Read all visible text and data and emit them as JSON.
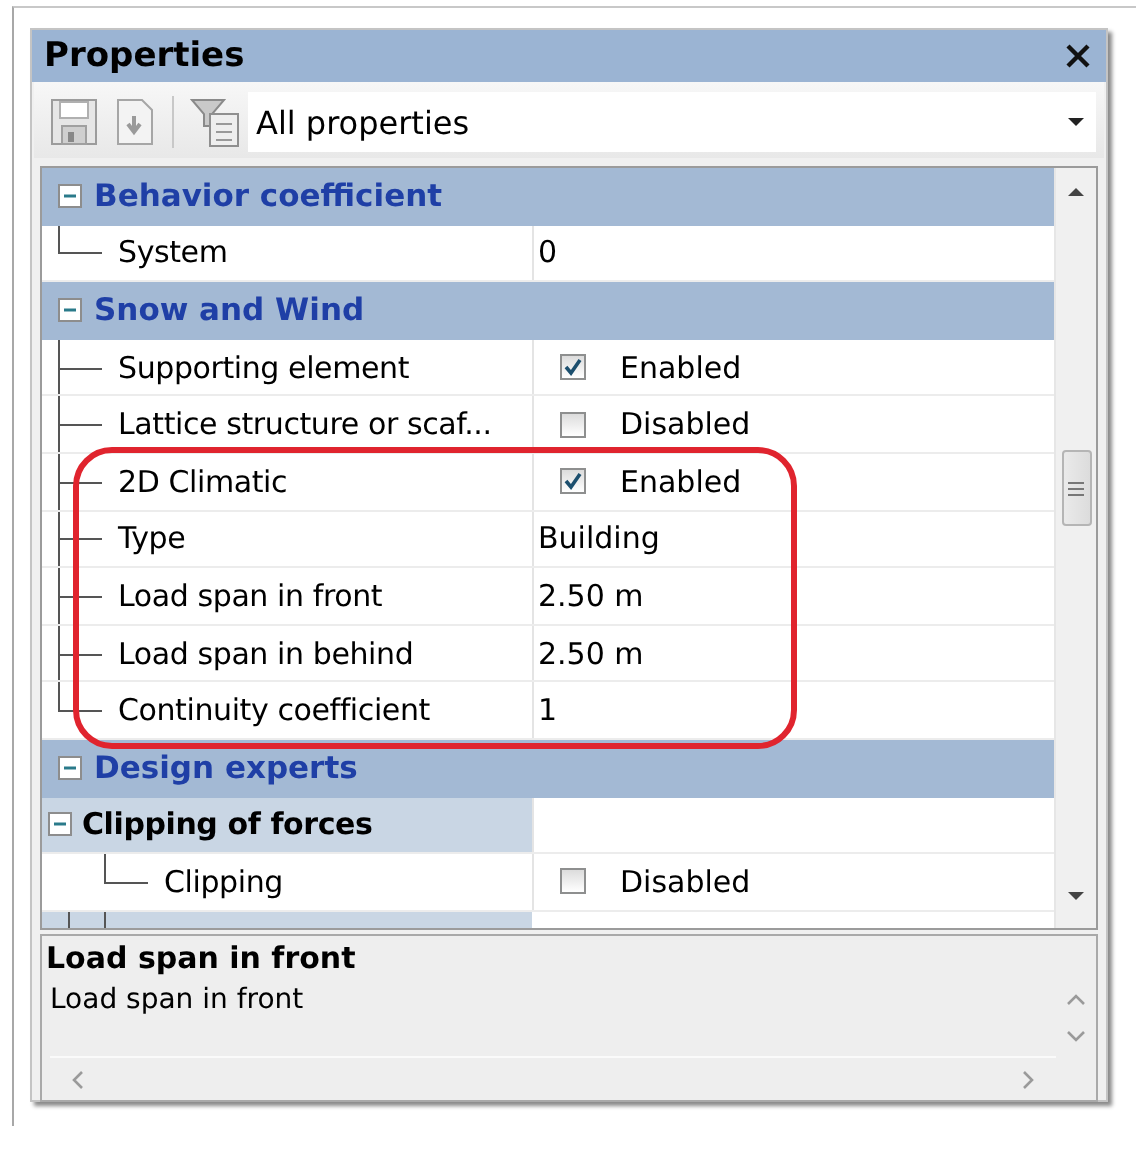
{
  "window": {
    "title": "Properties"
  },
  "toolbar": {
    "filter": "All properties"
  },
  "grid": {
    "categories": [
      {
        "name": "Behavior coefficient",
        "expanded": true,
        "children": [
          {
            "kind": "text",
            "label": "System",
            "value": "0"
          }
        ]
      },
      {
        "name": "Snow and Wind",
        "expanded": true,
        "children": [
          {
            "kind": "checkbox",
            "label": "Supporting element",
            "checked": true,
            "value": "Enabled"
          },
          {
            "kind": "checkbox",
            "label": "Lattice structure or scaf...",
            "checked": false,
            "value": "Disabled"
          },
          {
            "kind": "checkbox",
            "label": "2D Climatic",
            "checked": true,
            "value": "Enabled"
          },
          {
            "kind": "text",
            "label": "Type",
            "value": "Building"
          },
          {
            "kind": "text",
            "label": "Load span in front",
            "value": "2.50 m"
          },
          {
            "kind": "text",
            "label": "Load span in behind",
            "value": "2.50 m"
          },
          {
            "kind": "text",
            "label": "Continuity coefficient",
            "value": "1"
          }
        ]
      },
      {
        "name": "Design experts",
        "expanded": true,
        "children": [
          {
            "kind": "category",
            "label": "Clipping of forces",
            "expanded": true,
            "children": [
              {
                "kind": "checkbox",
                "label": "Clipping",
                "checked": false,
                "value": "Disabled"
              }
            ]
          }
        ]
      }
    ]
  },
  "description": {
    "title": "Load span in front",
    "text": "Load span in front"
  }
}
